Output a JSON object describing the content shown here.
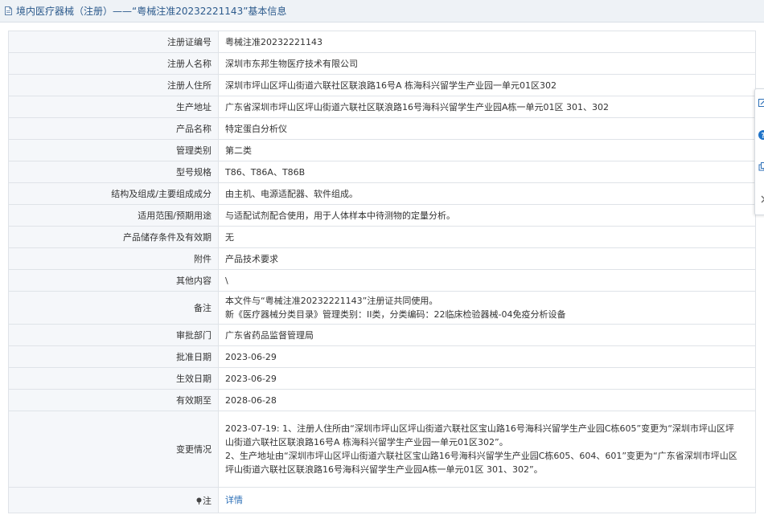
{
  "header": {
    "title": "境内医疗器械（注册）——“粤械注准20232221143”基本信息"
  },
  "rows": [
    {
      "label": "注册证编号",
      "lines": [
        "粤械注准20232221143"
      ]
    },
    {
      "label": "注册人名称",
      "lines": [
        "深圳市东邦生物医疗技术有限公司"
      ]
    },
    {
      "label": "注册人住所",
      "lines": [
        "深圳市坪山区坪山街道六联社区联浪路16号A 栋海科兴留学生产业园一单元01区302"
      ]
    },
    {
      "label": "生产地址",
      "lines": [
        "广东省深圳市坪山区坪山街道六联社区联浪路16号海科兴留学生产业园A栋一单元01区 301、302"
      ]
    },
    {
      "label": "产品名称",
      "lines": [
        "特定蛋白分析仪"
      ]
    },
    {
      "label": "管理类别",
      "lines": [
        "第二类"
      ]
    },
    {
      "label": "型号规格",
      "lines": [
        "T86、T86A、T86B"
      ]
    },
    {
      "label": "结构及组成/主要组成成分",
      "lines": [
        "由主机、电源适配器、软件组成。"
      ]
    },
    {
      "label": "适用范围/预期用途",
      "lines": [
        "与适配试剂配合使用，用于人体样本中待测物的定量分析。"
      ]
    },
    {
      "label": "产品储存条件及有效期",
      "lines": [
        "无"
      ]
    },
    {
      "label": "附件",
      "lines": [
        "产品技术要求"
      ]
    },
    {
      "label": "其他内容",
      "lines": [
        "\\"
      ]
    },
    {
      "label": "备注",
      "lines": [
        "本文件与“粤械注准20232221143”注册证共同使用。",
        "新《医疗器械分类目录》管理类别：II类，分类编码：22临床检验器械-04免疫分析设备"
      ]
    },
    {
      "label": "审批部门",
      "lines": [
        "广东省药品监督管理局"
      ]
    },
    {
      "label": "批准日期",
      "lines": [
        "2023-06-29"
      ]
    },
    {
      "label": "生效日期",
      "lines": [
        "2023-06-29"
      ]
    },
    {
      "label": "有效期至",
      "lines": [
        "2028-06-28"
      ]
    },
    {
      "label": "变更情况",
      "lines": [
        "2023-07-19: 1、注册人住所由“深圳市坪山区坪山街道六联社区宝山路16号海科兴留学生产业园C栋605”变更为“深圳市坪山区坪",
        "山街道六联社区联浪路16号A 栋海科兴留学生产业园一单元01区302”。",
        "2、生产地址由“深圳市坪山区坪山街道六联社区宝山路16号海科兴留学生产业园C栋605、604、601”变更为“广东省深圳市坪山区",
        "坪山街道六联社区联浪路16号海科兴留学生产业园A栋一单元01区 301、302”。"
      ]
    }
  ],
  "note": {
    "label": "注",
    "link": "详情"
  },
  "icons": {
    "title_icon": "document-icon",
    "note_icon": "pin-icon",
    "side_tools": [
      "edit-icon",
      "help-icon",
      "copy-icon",
      "chevron-right-icon"
    ]
  },
  "colors": {
    "title": "#2c5a8c",
    "link": "#2c6fb7",
    "label_bg": "#f5f7fa",
    "border": "#dfe3e8",
    "help_badge": "#1f73c8"
  }
}
